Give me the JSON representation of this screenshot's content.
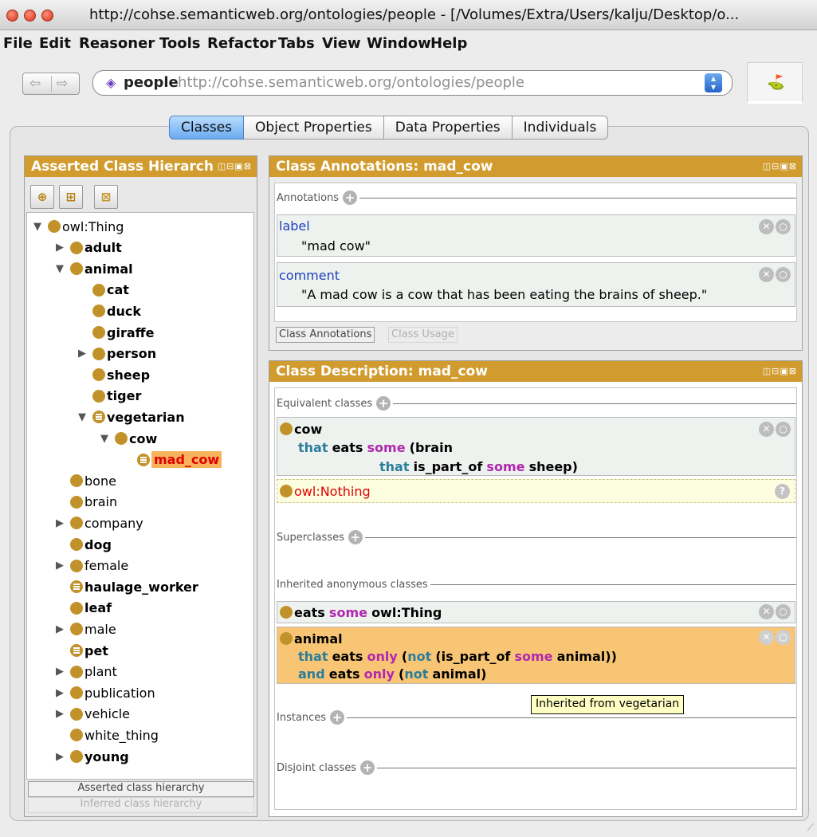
{
  "window": {
    "title": "http://cohse.semanticweb.org/ontologies/people - [/Volumes/Extra/Users/kalju/Desktop/o..."
  },
  "menu": [
    "File",
    "Edit",
    "Reasoner",
    "Tools",
    "Refactor",
    "Tabs",
    "View",
    "Window",
    "Help"
  ],
  "address": {
    "name": "people",
    "iri": "http://cohse.semanticweb.org/ontologies/people"
  },
  "tabs": [
    "Classes",
    "Object Properties",
    "Data Properties",
    "Individuals"
  ],
  "left_panel": {
    "title": "Asserted Class Hierarch",
    "tree": [
      {
        "label": "owl:Thing",
        "toggle": "▼",
        "bold": false,
        "def": false
      },
      {
        "label": "adult",
        "toggle": "▶",
        "bold": true,
        "def": false
      },
      {
        "label": "animal",
        "toggle": "▼",
        "bold": true,
        "def": false
      },
      {
        "label": "cat",
        "toggle": "",
        "bold": true,
        "def": false
      },
      {
        "label": "duck",
        "toggle": "",
        "bold": true,
        "def": false
      },
      {
        "label": "giraffe",
        "toggle": "",
        "bold": true,
        "def": false
      },
      {
        "label": "person",
        "toggle": "▶",
        "bold": true,
        "def": false
      },
      {
        "label": "sheep",
        "toggle": "",
        "bold": true,
        "def": false
      },
      {
        "label": "tiger",
        "toggle": "",
        "bold": true,
        "def": false
      },
      {
        "label": "vegetarian",
        "toggle": "▼",
        "bold": true,
        "def": true
      },
      {
        "label": "cow",
        "toggle": "▼",
        "bold": true,
        "def": false
      },
      {
        "label": "mad_cow",
        "toggle": "",
        "bold": true,
        "def": true,
        "selected": true
      },
      {
        "label": "bone",
        "toggle": "",
        "bold": false,
        "def": false
      },
      {
        "label": "brain",
        "toggle": "",
        "bold": false,
        "def": false
      },
      {
        "label": "company",
        "toggle": "▶",
        "bold": false,
        "def": false
      },
      {
        "label": "dog",
        "toggle": "",
        "bold": true,
        "def": false
      },
      {
        "label": "female",
        "toggle": "▶",
        "bold": false,
        "def": false
      },
      {
        "label": "haulage_worker",
        "toggle": "",
        "bold": true,
        "def": true
      },
      {
        "label": "leaf",
        "toggle": "",
        "bold": true,
        "def": false
      },
      {
        "label": "male",
        "toggle": "▶",
        "bold": false,
        "def": false
      },
      {
        "label": "pet",
        "toggle": "",
        "bold": true,
        "def": true
      },
      {
        "label": "plant",
        "toggle": "▶",
        "bold": false,
        "def": false
      },
      {
        "label": "publication",
        "toggle": "▶",
        "bold": false,
        "def": false
      },
      {
        "label": "vehicle",
        "toggle": "▶",
        "bold": false,
        "def": false
      },
      {
        "label": "white_thing",
        "toggle": "",
        "bold": false,
        "def": false
      },
      {
        "label": "young",
        "toggle": "▶",
        "bold": true,
        "def": false
      }
    ],
    "hierarchy_buttons": [
      "Asserted class hierarchy",
      "Inferred class hierarchy"
    ]
  },
  "annotations_panel": {
    "title": "Class Annotations: mad_cow",
    "section": "Annotations",
    "items": [
      {
        "property": "label",
        "value": "\"mad cow\""
      },
      {
        "property": "comment",
        "value": "\"A mad cow is a cow that has been eating the brains of sheep.\""
      }
    ],
    "tabs": [
      "Class Annotations",
      "Class Usage"
    ]
  },
  "description_panel": {
    "title": "Class Description: mad_cow",
    "sections": {
      "equivalent": "Equivalent classes",
      "superclasses": "Superclasses",
      "inherited": "Inherited anonymous classes",
      "instances": "Instances",
      "disjoint": "Disjoint classes"
    },
    "equiv_expr": {
      "l1": "cow",
      "l2_that": "that",
      "l2_eats": "eats",
      "l2_some": "some",
      "l2_rest": "(brain",
      "l3_that": "that",
      "l3_prop": "is_part_of",
      "l3_some": "some",
      "l3_rest": "sheep)"
    },
    "inferred_nothing": "owl:Nothing",
    "inherited1": {
      "a": "eats",
      "b": "some",
      "c": "owl:Thing"
    },
    "inherited2": {
      "l1": "animal",
      "l2": [
        "that",
        "eats",
        "only",
        "(",
        "not",
        "(is_part_of",
        "some",
        "animal))"
      ],
      "l3": [
        "and",
        "eats",
        "only",
        "(",
        "not",
        "animal)"
      ]
    },
    "tooltip": "Inherited from vegetarian"
  },
  "colors": {
    "accent": "#d19b2e",
    "selected_bg": "#f7b25c",
    "selected_text": "#e00000",
    "keyword_blue": "#2a7d9c",
    "keyword_purple": "#b027b0"
  }
}
